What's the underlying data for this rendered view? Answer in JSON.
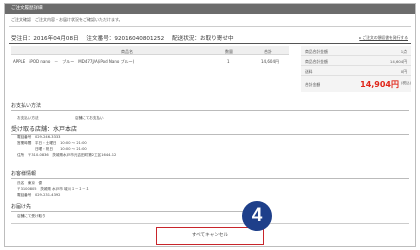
{
  "header": {
    "bar_title": "ご注文履歴詳細",
    "intro": "ご注文確認　ご注文内容・お届け状況をご確認いただけます。"
  },
  "order": {
    "date": "受注日：2016年04月08日",
    "number": "注文番号：92016040801252",
    "status": "配送状況：お取り寄せ中",
    "receipt_link": "▸ ご注文の領収書を発行する"
  },
  "items_table": {
    "headers": {
      "product": "商品名",
      "qty": "数量",
      "subtotal": "合計"
    },
    "rows": [
      {
        "name": "APPLE　iPOD nano　－　ブルー　MD477J/A(iPod Nano ブルー)",
        "qty": "1",
        "subtotal": "14,604円"
      }
    ]
  },
  "summary": {
    "rows": [
      {
        "label": "商品合計金額",
        "value": "1点"
      },
      {
        "label": "商品合計金額",
        "value": "14,604円"
      },
      {
        "label": "送料",
        "value": "0円"
      }
    ],
    "total_label": "合計金額",
    "total_value": "14,904円",
    "tax_note": "(税込)"
  },
  "payment": {
    "title": "お支払い方法",
    "label": "お支払い方法",
    "value": "店舗にてお支払い"
  },
  "store": {
    "title": "受け取る店舗：水戸本店",
    "lines": [
      "電話番号　029-246-3333",
      "営業時間　平日・土曜日　10:00 ～ 21:00",
      "　　　　　日曜・祝日　　10:00 ～ 21:00",
      "住所　〒310-0836　茨城県水戸市元吉田町第2工区1644-12"
    ]
  },
  "customer": {
    "title": "お客様情報",
    "lines": [
      "氏名　東京　優",
      "〒3100805　茨城県 水戸市 城川１－１－１",
      "電話番号　029-231-4392"
    ]
  },
  "notes": {
    "title": "お届け先",
    "value": "店舗にて受け取り"
  },
  "actions": {
    "cancel_all": "すべてキャンセル",
    "step_badge": "4"
  },
  "colors": {
    "accent_red": "#e0261a",
    "button_border": "#c8252b",
    "badge_blue": "#1e3f8a"
  }
}
